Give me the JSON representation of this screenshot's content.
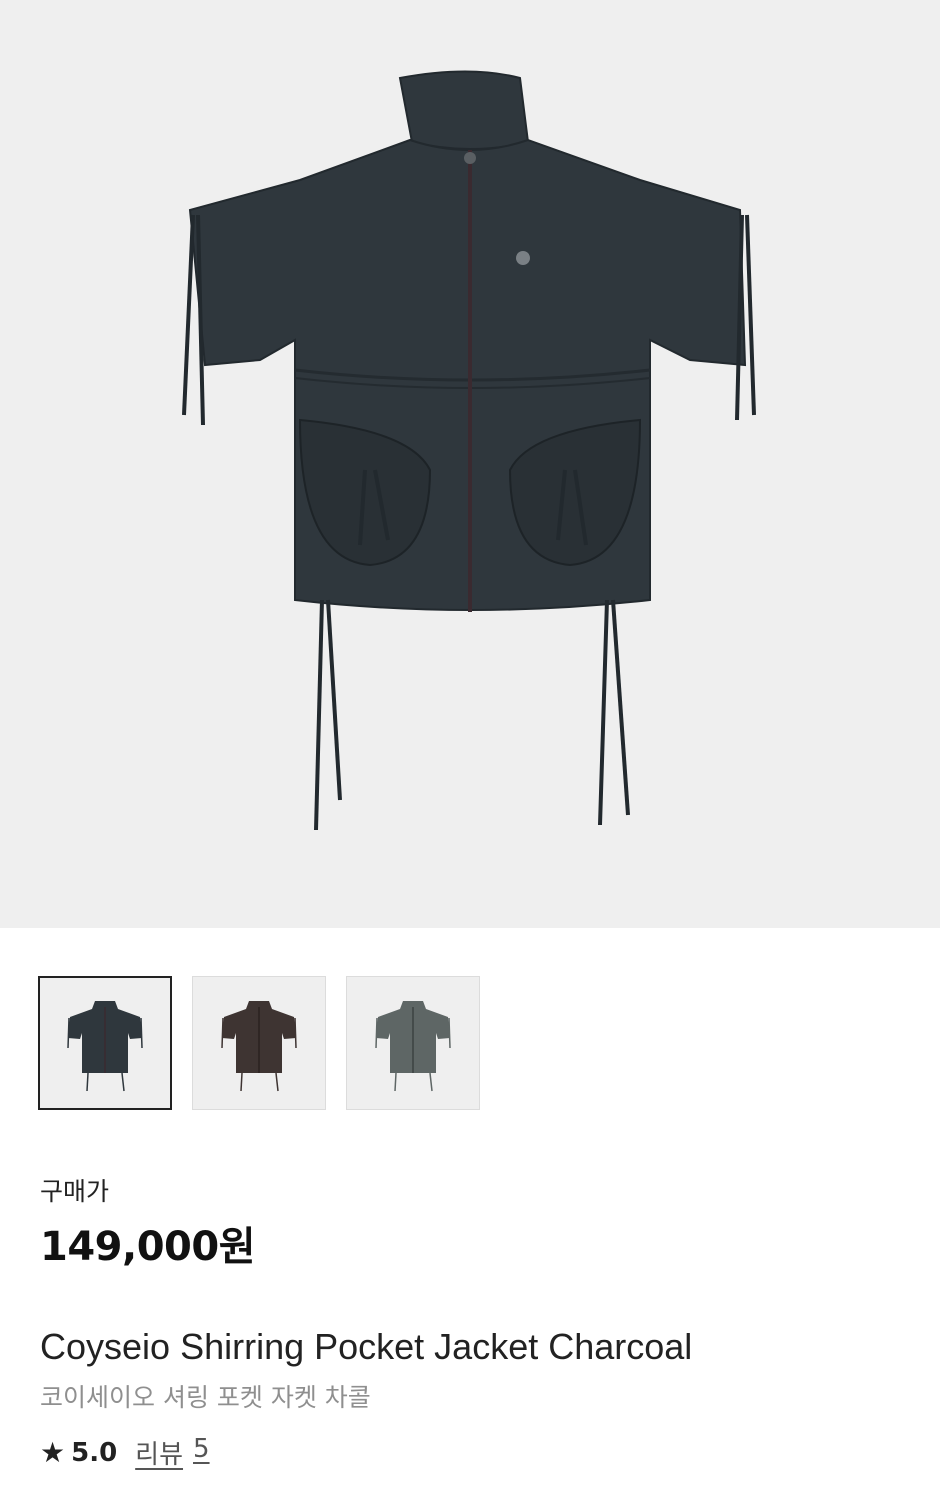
{
  "product": {
    "image_alt": "Coyseio Shirring Pocket Jacket Charcoal",
    "thumbnails": [
      {
        "color_name": "charcoal",
        "color": "#2f373d",
        "selected": true
      },
      {
        "color_name": "brown",
        "color": "#3e3432",
        "selected": false
      },
      {
        "color_name": "grey",
        "color": "#5e6665",
        "selected": false
      }
    ],
    "price_label": "구매가",
    "price": "149,000원",
    "name_en": "Coyseio Shirring Pocket Jacket Charcoal",
    "name_ko": "코이세이오 셔링 포켓 자켓 차콜",
    "rating": "5.0",
    "review_label": "리뷰",
    "review_count": "5"
  },
  "colors": {
    "hero_background": "#efefef",
    "jacket": "#2f373d",
    "zipper": "#3a2a30"
  },
  "icons": {
    "star": "star-icon"
  }
}
